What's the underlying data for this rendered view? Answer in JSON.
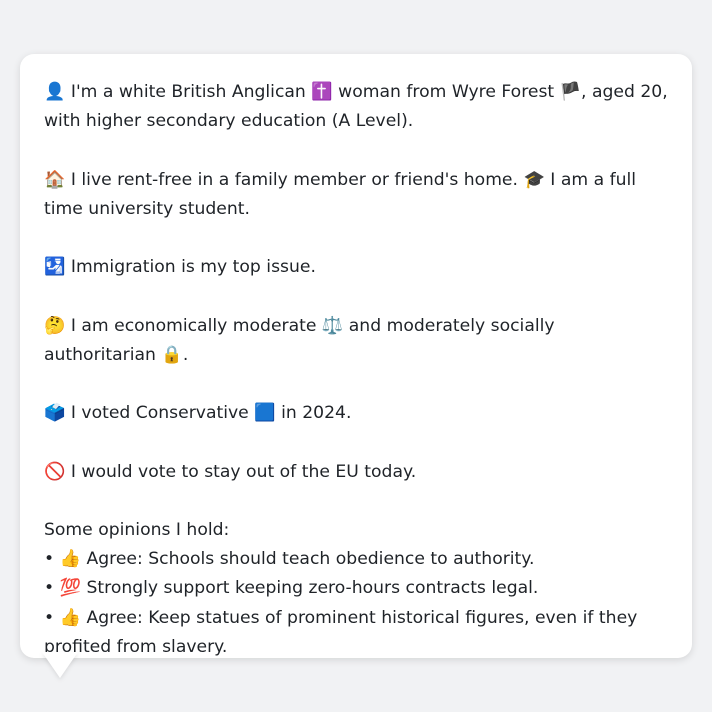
{
  "profile": {
    "identity": {
      "icon": "👤",
      "text_a": " I'm a white British Anglican ",
      "religion_icon": "✝️",
      "text_b": " woman from Wyre Forest ",
      "flag_icon": "🏴",
      "text_c": ", aged 20, with higher secondary education (A Level)."
    },
    "living": {
      "home_icon": "🏠",
      "home_text": " I live rent-free in a family member or friend's home. ",
      "study_icon": "🎓",
      "study_text": " I am a full time university student."
    },
    "issue": {
      "icon": "🛂",
      "text": " Immigration is my top issue."
    },
    "ideology": {
      "icon": "🤔",
      "text_a": " I am economically moderate ",
      "scale_icon": "⚖️",
      "text_b": " and moderately socially authoritarian ",
      "lock_icon": "🔒",
      "text_c": "."
    },
    "vote": {
      "icon": "🗳️",
      "text_a": " I voted Conservative ",
      "party_icon": "🟦",
      "text_b": " in 2024."
    },
    "eu": {
      "icon": "🚫",
      "text": " I would vote to stay out of the EU today."
    },
    "opinions_heading": "Some opinions I hold:",
    "opinions": [
      {
        "bullet": "• ",
        "icon": "👍",
        "text": " Agree: Schools should teach obedience to authority."
      },
      {
        "bullet": "• ",
        "icon": "💯",
        "text": " Strongly support keeping zero-hours contracts legal."
      },
      {
        "bullet": "• ",
        "icon": "👍",
        "text": " Agree: Keep statues of prominent historical figures, even if they profited from slavery."
      }
    ]
  }
}
